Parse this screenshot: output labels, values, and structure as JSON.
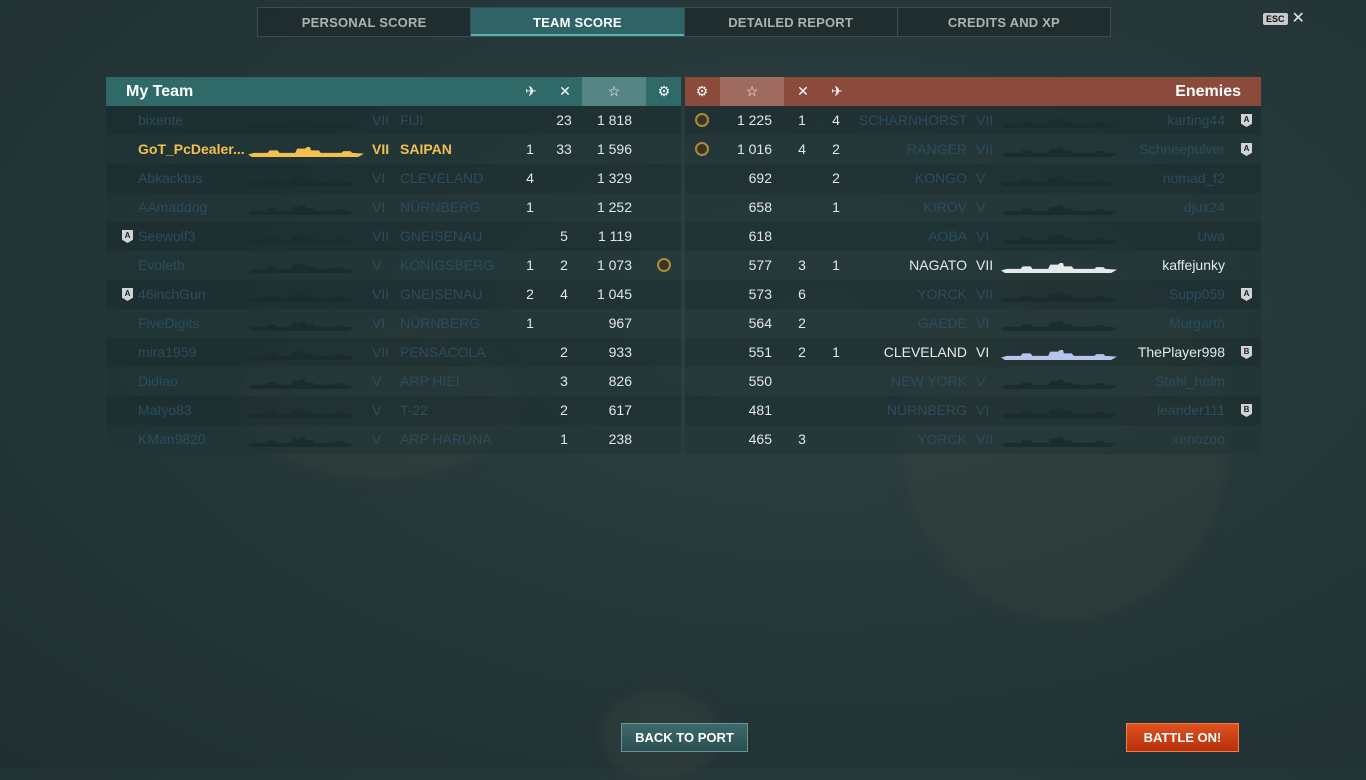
{
  "tabs": [
    "PERSONAL SCORE",
    "TEAM SCORE",
    "DETAILED REPORT",
    "CREDITS AND XP"
  ],
  "active_tab": 1,
  "esc": {
    "key": "ESC",
    "close": "✕"
  },
  "my_team": {
    "title": "My Team",
    "headers": {
      "planes": "✈",
      "kills": "✕",
      "score": "☆",
      "medal": "⚙"
    },
    "rows": [
      {
        "name": "bixente",
        "tier": "VII",
        "ship": "FIJI",
        "planes": "",
        "kills": "23",
        "score": "1 818",
        "badge": "",
        "medal": false,
        "state": "dim"
      },
      {
        "name": "GoT_PcDealer...",
        "tier": "VII",
        "ship": "SAIPAN",
        "planes": "1",
        "kills": "33",
        "score": "1 596",
        "badge": "",
        "medal": false,
        "state": "self"
      },
      {
        "name": "Abkacktus",
        "tier": "VI",
        "ship": "CLEVELAND",
        "planes": "4",
        "kills": "",
        "score": "1 329",
        "badge": "",
        "medal": false,
        "state": "dim"
      },
      {
        "name": "AAmaddog",
        "tier": "VI",
        "ship": "NÜRNBERG",
        "planes": "1",
        "kills": "",
        "score": "1 252",
        "badge": "",
        "medal": false,
        "state": "dim"
      },
      {
        "name": "Seewolf3",
        "tier": "VII",
        "ship": "GNEISENAU",
        "planes": "",
        "kills": "5",
        "score": "1 119",
        "badge": "A",
        "medal": false,
        "state": "dim"
      },
      {
        "name": "Evoleth",
        "tier": "V",
        "ship": "KÖNIGSBERG",
        "planes": "1",
        "kills": "2",
        "score": "1 073",
        "badge": "",
        "medal": true,
        "state": "dim"
      },
      {
        "name": "46inchGun",
        "tier": "VII",
        "ship": "GNEISENAU",
        "planes": "2",
        "kills": "4",
        "score": "1 045",
        "badge": "A",
        "medal": false,
        "state": "dim"
      },
      {
        "name": "FiveDigits",
        "tier": "VI",
        "ship": "NÜRNBERG",
        "planes": "1",
        "kills": "",
        "score": "967",
        "badge": "",
        "medal": false,
        "state": "dim"
      },
      {
        "name": "mira1959",
        "tier": "VII",
        "ship": "PENSACOLA",
        "planes": "",
        "kills": "2",
        "score": "933",
        "badge": "",
        "medal": false,
        "state": "dim"
      },
      {
        "name": "Didiao",
        "tier": "V",
        "ship": "ARP HIEI",
        "planes": "",
        "kills": "3",
        "score": "826",
        "badge": "",
        "medal": false,
        "state": "dim"
      },
      {
        "name": "Matyo83",
        "tier": "V",
        "ship": "T-22",
        "planes": "",
        "kills": "2",
        "score": "617",
        "badge": "",
        "medal": false,
        "state": "dim"
      },
      {
        "name": "KMan9820",
        "tier": "V",
        "ship": "ARP HARUNA",
        "planes": "",
        "kills": "1",
        "score": "238",
        "badge": "",
        "medal": false,
        "state": "dim"
      }
    ]
  },
  "enemies": {
    "title": "Enemies",
    "headers": {
      "medal": "⚙",
      "score": "☆",
      "kills": "✕",
      "planes": "✈"
    },
    "rows": [
      {
        "name": "karting44",
        "tier": "VII",
        "ship": "SCHARNHORST",
        "planes": "4",
        "kills": "1",
        "score": "1 225",
        "badge": "A",
        "medal": true,
        "state": "dim"
      },
      {
        "name": "Schneepulver",
        "tier": "VII",
        "ship": "RANGER",
        "planes": "2",
        "kills": "4",
        "score": "1 016",
        "badge": "A",
        "medal": true,
        "state": "dim"
      },
      {
        "name": "nomad_f2",
        "tier": "V",
        "ship": "KONGO",
        "planes": "2",
        "kills": "",
        "score": "692",
        "badge": "",
        "medal": false,
        "state": "dim"
      },
      {
        "name": "djux24",
        "tier": "V",
        "ship": "KIROV",
        "planes": "1",
        "kills": "",
        "score": "658",
        "badge": "",
        "medal": false,
        "state": "dim"
      },
      {
        "name": "Uwa",
        "tier": "VI",
        "ship": "AOBA",
        "planes": "",
        "kills": "",
        "score": "618",
        "badge": "",
        "medal": false,
        "state": "dim"
      },
      {
        "name": "kaffejunky",
        "tier": "VII",
        "ship": "NAGATO",
        "planes": "1",
        "kills": "3",
        "score": "577",
        "badge": "",
        "medal": false,
        "state": "alive"
      },
      {
        "name": "Supp059",
        "tier": "VII",
        "ship": "YORCK",
        "planes": "",
        "kills": "6",
        "score": "573",
        "badge": "A",
        "medal": false,
        "state": "dim"
      },
      {
        "name": "Murgarth",
        "tier": "VI",
        "ship": "GAEDE",
        "planes": "",
        "kills": "2",
        "score": "564",
        "badge": "",
        "medal": false,
        "state": "dim"
      },
      {
        "name": "ThePlayer998",
        "tier": "VI",
        "ship": "CLEVELAND",
        "planes": "1",
        "kills": "2",
        "score": "551",
        "badge": "B",
        "medal": false,
        "state": "alive"
      },
      {
        "name": "Stahl_helm",
        "tier": "V",
        "ship": "NEW YORK",
        "planes": "",
        "kills": "",
        "score": "550",
        "badge": "",
        "medal": false,
        "state": "dim"
      },
      {
        "name": "leander111",
        "tier": "VI",
        "ship": "NÜRNBERG",
        "planes": "",
        "kills": "",
        "score": "481",
        "badge": "B",
        "medal": false,
        "state": "dim"
      },
      {
        "name": "xenozoo",
        "tier": "VII",
        "ship": "YORCK",
        "planes": "",
        "kills": "3",
        "score": "465",
        "badge": "",
        "medal": false,
        "state": "dim"
      }
    ]
  },
  "buttons": {
    "back": "BACK TO PORT",
    "battle": "BATTLE ON!"
  },
  "colors": {
    "self": "#f3c050",
    "dim": "#2e5060",
    "ally_header": "#2f6a68",
    "enemy_header": "#8a4a3c",
    "battle_button": "#d24418"
  }
}
